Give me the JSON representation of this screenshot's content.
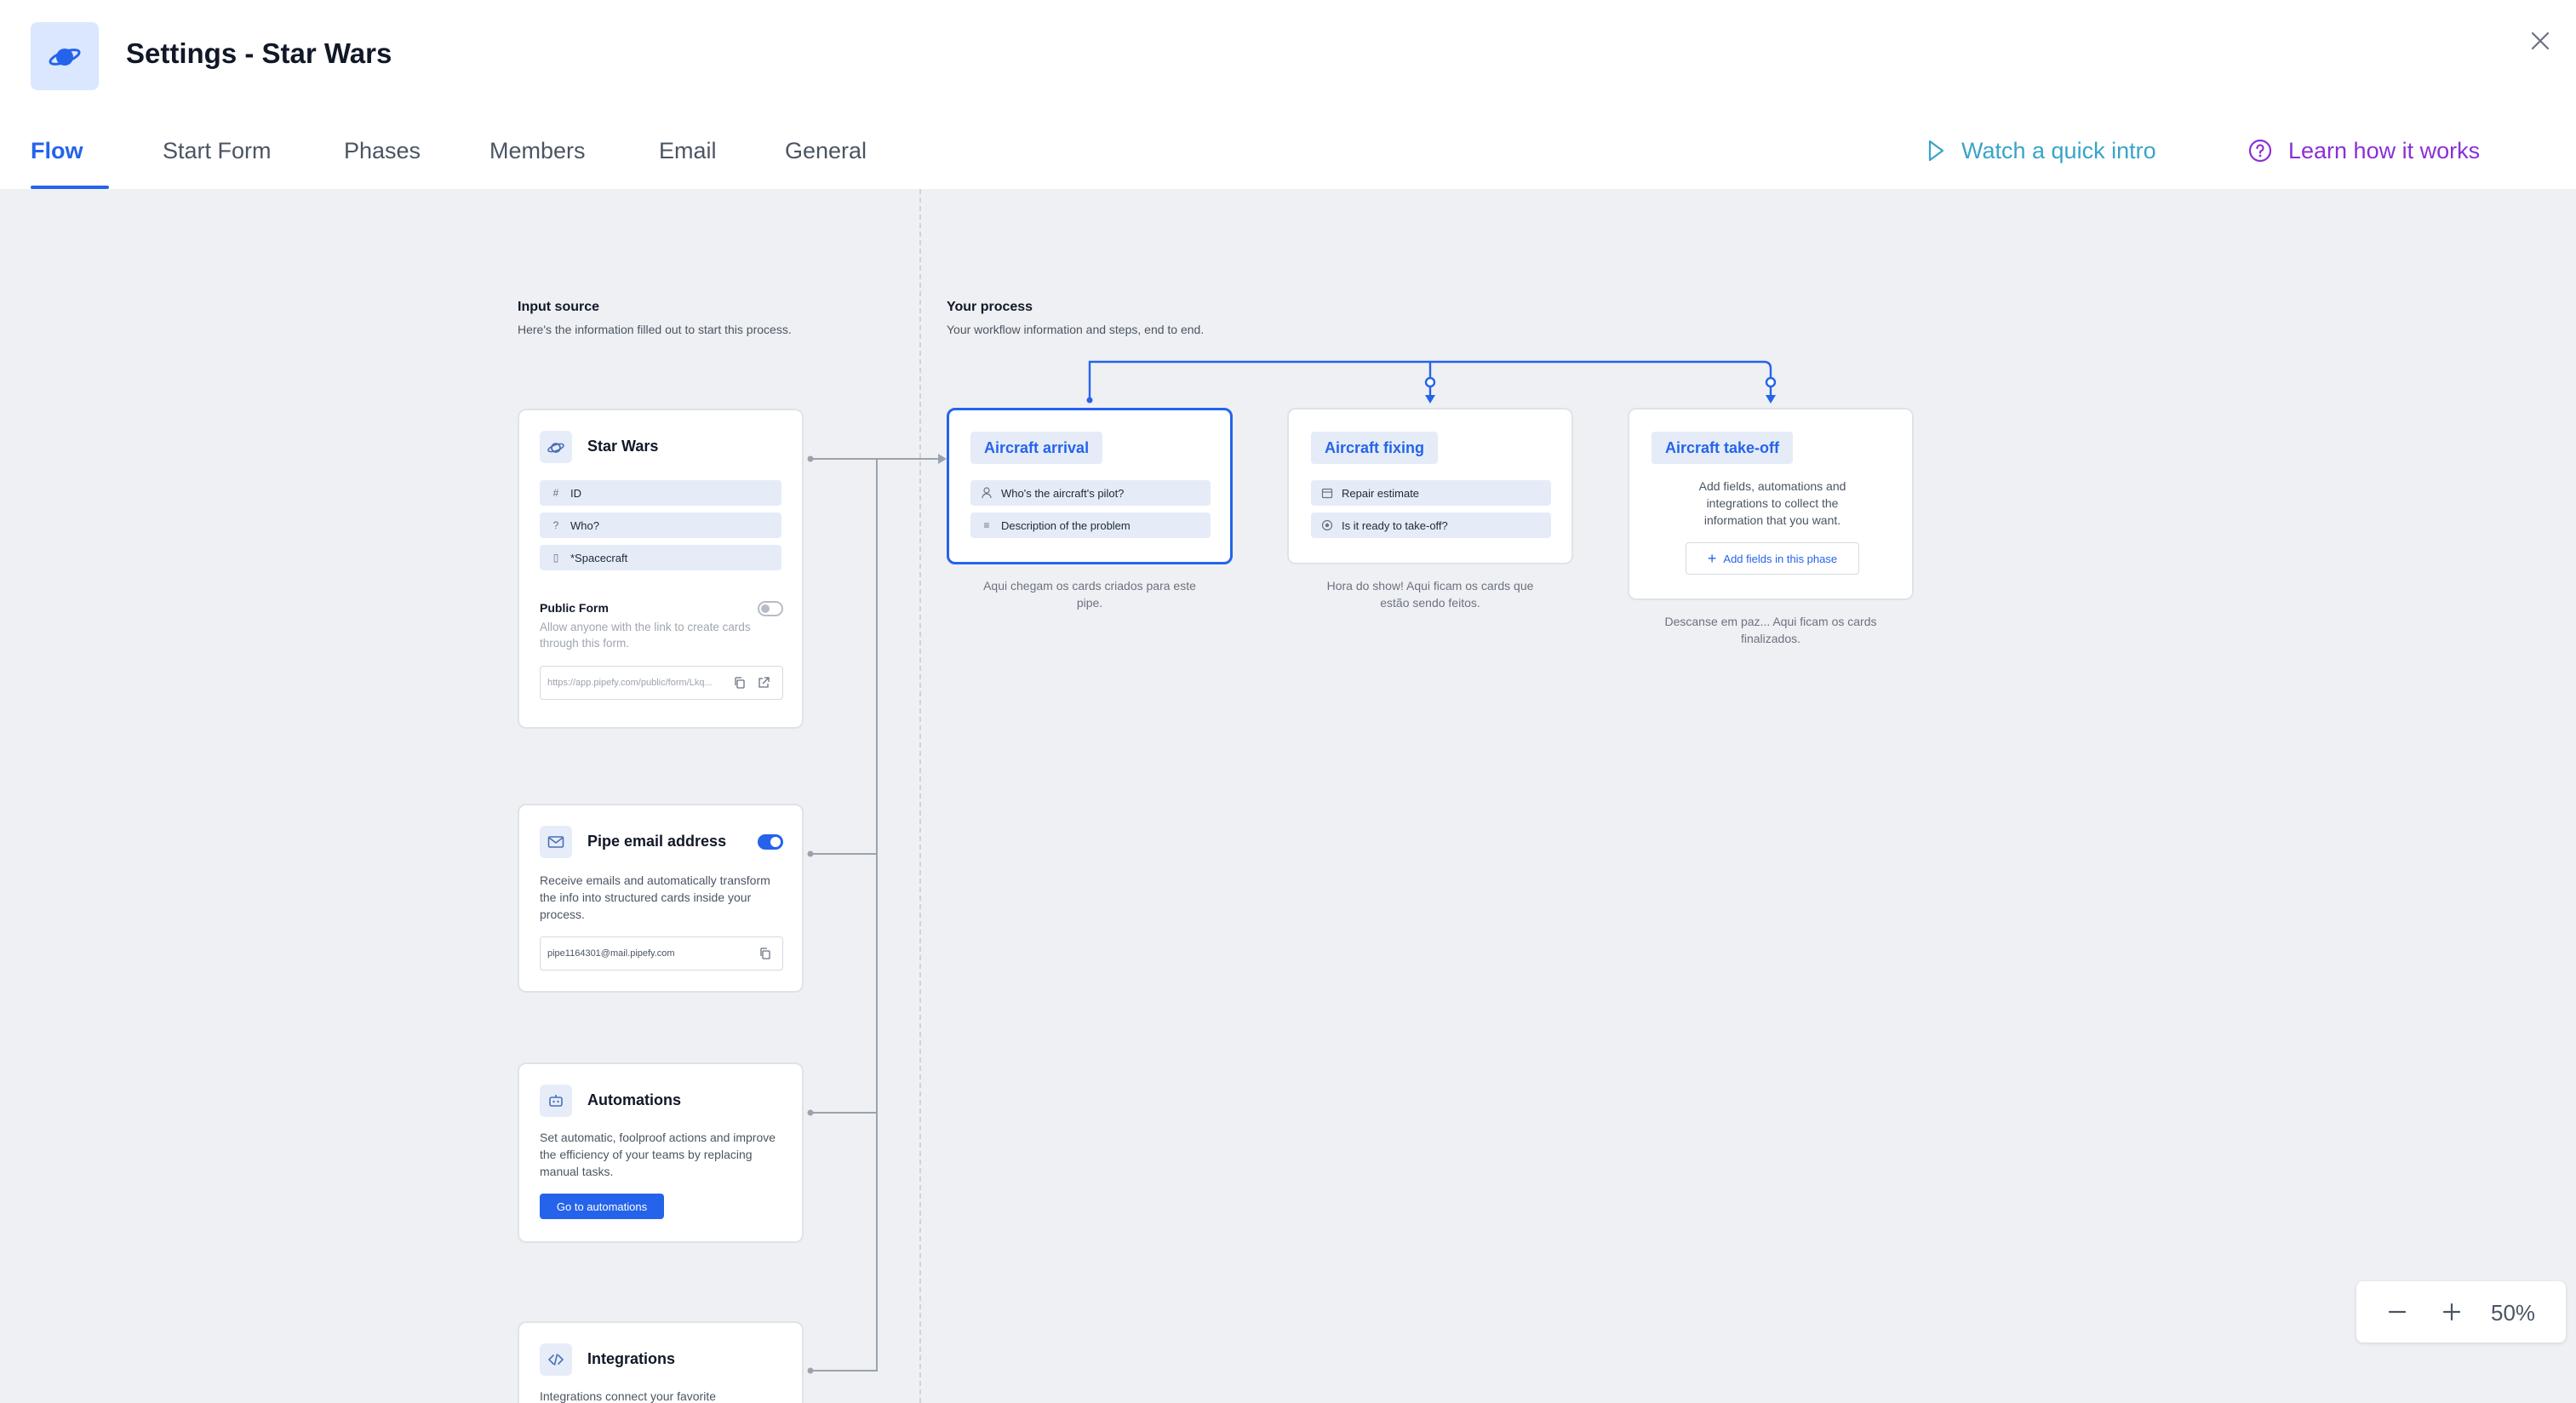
{
  "header": {
    "title": "Settings - Star Wars",
    "app_icon": "planet-icon"
  },
  "tabs": [
    {
      "label": "Flow",
      "active": true
    },
    {
      "label": "Start Form",
      "active": false
    },
    {
      "label": "Phases",
      "active": false
    },
    {
      "label": "Members",
      "active": false
    },
    {
      "label": "Email",
      "active": false
    },
    {
      "label": "General",
      "active": false
    }
  ],
  "links": {
    "watch_intro": "Watch a quick intro",
    "learn_how": "Learn how it works"
  },
  "input_source": {
    "title": "Input source",
    "subtitle": "Here's the information filled out to start this process.",
    "start_form": {
      "title": "Star Wars",
      "fields": [
        "ID",
        "Who?",
        "*Spacecraft"
      ],
      "public_form_label": "Public Form",
      "public_form_desc": "Allow anyone with the link to create cards through this form.",
      "public_form_enabled": false,
      "url": "https://app.pipefy.com/public/form/Lkq..."
    },
    "email": {
      "title": "Pipe email address",
      "enabled": true,
      "desc": "Receive emails and automatically transform the info into structured cards inside your process.",
      "address": "pipe1164301@mail.pipefy.com"
    },
    "automations": {
      "title": "Automations",
      "desc": "Set automatic, foolproof actions and improve the efficiency of your teams by replacing manual tasks.",
      "button": "Go to automations"
    },
    "integrations": {
      "title": "Integrations",
      "desc": "Integrations connect your favorite"
    }
  },
  "process": {
    "title": "Your process",
    "subtitle": "Your workflow information and steps, end to end.",
    "phases": [
      {
        "name": "Aircraft arrival",
        "fields": [
          "Who's the aircraft's pilot?",
          "Description of the problem"
        ],
        "caption": "Aqui chegam os cards criados para este pipe."
      },
      {
        "name": "Aircraft fixing",
        "fields": [
          "Repair estimate",
          "Is it ready to take-off?"
        ],
        "caption": "Hora do show! Aqui ficam os cards que estão sendo feitos."
      },
      {
        "name": "Aircraft take-off",
        "empty_text": "Add fields, automations and integrations to collect the information that you want.",
        "add_label": "Add fields in this phase",
        "caption": "Descanse em paz... Aqui ficam os cards finalizados."
      }
    ]
  },
  "zoom": {
    "value": "50%"
  },
  "colors": {
    "accent": "#2563eb",
    "watch": "#38a4c8",
    "learn": "#8b2fd6",
    "canvas": "#eef0f3"
  }
}
